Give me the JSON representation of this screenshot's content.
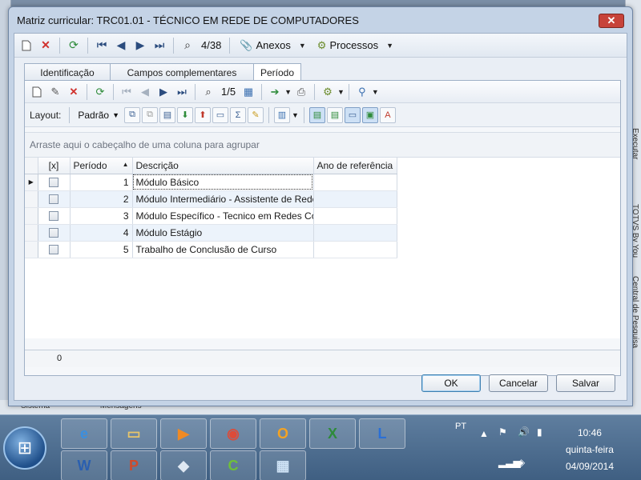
{
  "window": {
    "title": "Matriz curricular: TRC01.01 - TÉCNICO EM REDE DE COMPUTADORES",
    "close_label": "✕"
  },
  "main_toolbar": {
    "record_position": "4/38",
    "anexos_label": "Anexos",
    "processos_label": "Processos"
  },
  "tabs": [
    {
      "label": "Identificação",
      "active": false
    },
    {
      "label": "Campos complementares",
      "active": false
    },
    {
      "label": "Período",
      "active": true
    }
  ],
  "sub_toolbar": {
    "record_position": "1/5"
  },
  "layout_bar": {
    "label": "Layout:",
    "padrao_label": "Padrão"
  },
  "group_hint": "Arraste aqui o cabeçalho de uma coluna para agrupar",
  "grid": {
    "columns": [
      "[x]",
      "Período",
      "Descrição",
      "Ano de referência"
    ],
    "sort_indicator": "▲",
    "rows": [
      {
        "checked": false,
        "periodo": "1",
        "descricao": "Módulo Básico",
        "ano": ""
      },
      {
        "checked": false,
        "periodo": "2",
        "descricao": "Módulo Intermediário - Assistente de Redes",
        "ano": ""
      },
      {
        "checked": false,
        "periodo": "3",
        "descricao": "Módulo Específico - Tecnico em Redes Comp...",
        "ano": ""
      },
      {
        "checked": false,
        "periodo": "4",
        "descricao": "Módulo Estágio",
        "ano": ""
      },
      {
        "checked": false,
        "periodo": "5",
        "descricao": "Trabalho de Conclusão de Curso",
        "ano": ""
      }
    ],
    "footer_count": "0"
  },
  "buttons": {
    "ok": "OK",
    "cancel": "Cancelar",
    "save": "Salvar"
  },
  "background": {
    "bottom_tabs": [
      "Sistema",
      "Mensagens"
    ],
    "right_tabs": [
      "Executar",
      "TOTVS By You",
      "Central de Pesquisa"
    ]
  },
  "taskbar": {
    "apps": [
      {
        "icon": "internet-explorer-icon",
        "glyph": "e"
      },
      {
        "icon": "folder-icon",
        "glyph": "▭"
      },
      {
        "icon": "media-player-icon",
        "glyph": "▶"
      },
      {
        "icon": "chrome-icon",
        "glyph": "◉"
      },
      {
        "icon": "outlook-icon",
        "glyph": "O"
      },
      {
        "icon": "excel-icon",
        "glyph": "X"
      },
      {
        "icon": "lync-icon",
        "glyph": "L"
      },
      {
        "icon": "word-icon",
        "glyph": "W"
      },
      {
        "icon": "powerpoint-icon",
        "glyph": "P"
      },
      {
        "icon": "app-icon",
        "glyph": "◆"
      },
      {
        "icon": "camtasia-icon",
        "glyph": "C"
      },
      {
        "icon": "totvs-icon",
        "glyph": "▦"
      }
    ],
    "language": "PT",
    "time": "10:46",
    "day": "quinta-feira",
    "date": "04/09/2014"
  }
}
